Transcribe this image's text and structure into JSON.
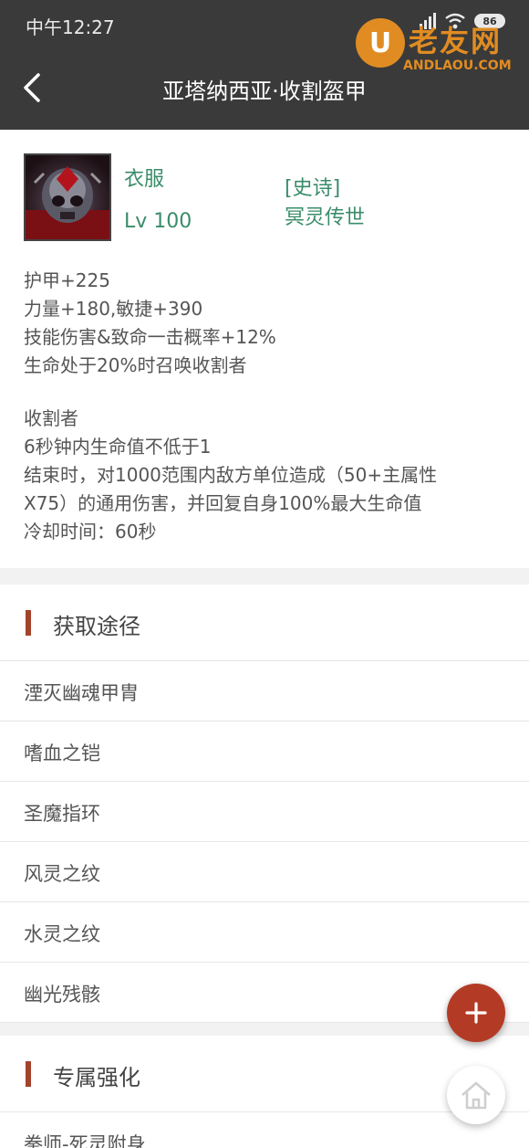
{
  "status_bar": {
    "time": "中午12:27",
    "battery": "86"
  },
  "watermark": {
    "logo_letter": "U",
    "cn": "老友网",
    "en": "ANDLAOU.COM"
  },
  "header": {
    "title": "亚塔纳西亚·收割盔甲"
  },
  "item": {
    "icon": "skull-armor-icon",
    "type": "衣服",
    "level": "Lv 100",
    "quality": "[史诗]",
    "set_name": "冥灵传世",
    "attributes": [
      "护甲+225",
      "力量+180,敏捷+390",
      "技能伤害&致命一击概率+12%",
      "生命处于20%时召唤收割者"
    ],
    "skill": [
      "收割者",
      "6秒钟内生命值不低于1",
      "结束时，对1000范围内敌方单位造成（50+主属性",
      "X75）的通用伤害，并回复自身100%最大生命值",
      "冷却时间：60秒"
    ]
  },
  "obtain": {
    "title": "获取途径",
    "items": [
      "湮灭幽魂甲胄",
      "嗜血之铠",
      "圣魔指环",
      "风灵之纹",
      "水灵之纹",
      "幽光残骸"
    ]
  },
  "exclusive": {
    "title": "专属强化",
    "items": [
      "拳师-死灵附身"
    ]
  },
  "colors": {
    "header_bg": "#3a3a3a",
    "accent": "#a3432c",
    "item_text": "#3a8c6a",
    "fab": "#b33b26"
  },
  "fab": {
    "add_icon": "plus-icon",
    "home_icon": "home-icon"
  }
}
